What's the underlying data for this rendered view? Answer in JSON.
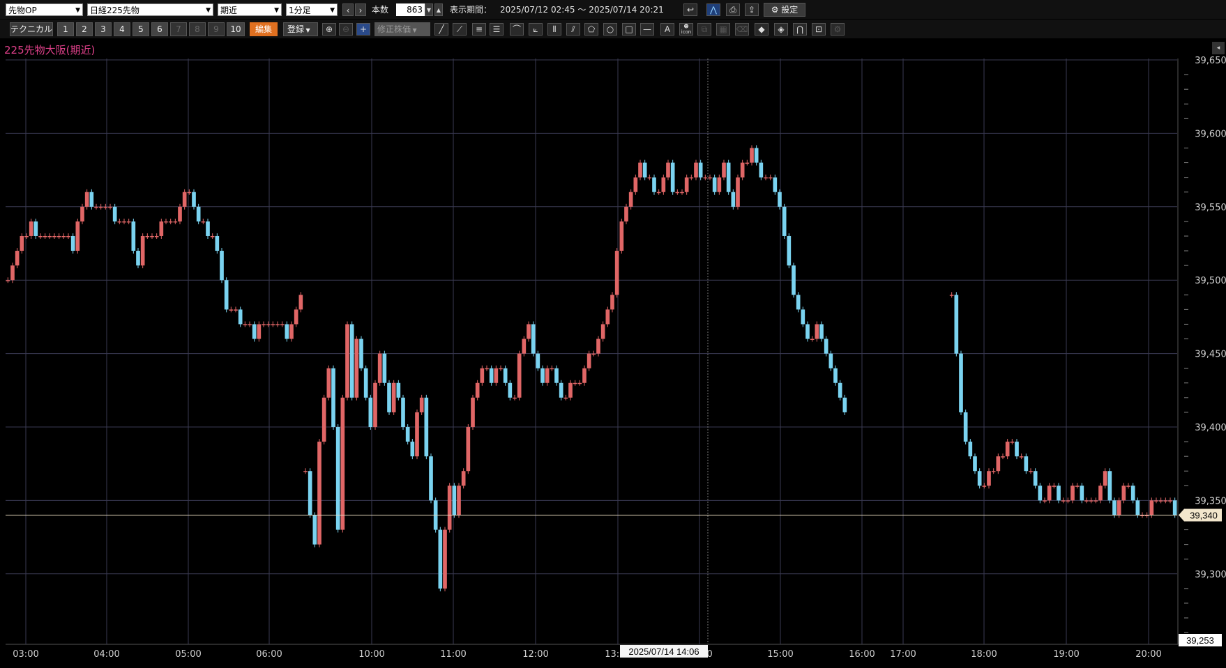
{
  "toolbar": {
    "market_select": "先物OP",
    "instrument_select": "日経225先物",
    "contract_select": "期近",
    "interval_select": "1分足",
    "prev_label": "‹",
    "next_label": "›",
    "count_label": "本数",
    "count_value": "863",
    "period_label": "表示期間：",
    "period_value": "2025/07/12 02:45 ～ 2025/07/14 20:21",
    "settings_label": "設定"
  },
  "toolbar2": {
    "technical_label": "テクニカル",
    "presets": [
      "1",
      "2",
      "3",
      "4",
      "5",
      "6",
      "7",
      "8",
      "9",
      "10"
    ],
    "edit_label": "編集",
    "register_label": "登録",
    "adjusted_price_label": "修正株価",
    "icon_label": "icon"
  },
  "chart_title": "225先物大阪(期近)",
  "colors": {
    "up": "#e06666",
    "down": "#7ad3f0",
    "grid": "#3a3a52",
    "title": "#e0408a",
    "price_line": "#e8dcc0"
  },
  "chart_data": {
    "type": "line",
    "x_tick_labels": [
      "03:00",
      "04:00",
      "05:00",
      "06:00",
      "10:00",
      "11:00",
      "12:00",
      "13:00",
      "14:00",
      "15:00",
      "16:00",
      "17:00",
      "18:00",
      "19:00",
      "20:00"
    ],
    "y_tick_labels": [
      "39,650",
      "39,600",
      "39,550",
      "39,500",
      "39,450",
      "39,400",
      "39,350",
      "39,300"
    ],
    "ylim": [
      39253,
      39650
    ],
    "current_price_label": "39,340",
    "current_price": 39340,
    "axis_min_label": "39,253",
    "crosshair_time_label": "2025/07/14 14:06",
    "segments": [
      {
        "start": 0,
        "values": [
          39500,
          39510,
          39520,
          39530,
          39530,
          39540,
          39530,
          39530,
          39530,
          39530,
          39530,
          39530,
          39530,
          39530,
          39520,
          39540,
          39550,
          39560,
          39550,
          39550,
          39550,
          39550,
          39550,
          39540,
          39540,
          39540,
          39540,
          39520,
          39510,
          39530,
          39530,
          39530,
          39530,
          39540,
          39540,
          39540,
          39540,
          39550,
          39560,
          39560,
          39550,
          39540,
          39540,
          39530,
          39530,
          39520,
          39500,
          39480,
          39480,
          39480,
          39470,
          39470,
          39470,
          39460,
          39470,
          39470,
          39470,
          39470,
          39470,
          39470,
          39460,
          39470,
          39480,
          39490
        ]
      },
      {
        "start": 64,
        "values": [
          39370,
          39340,
          39320,
          39390,
          39420,
          39440,
          39400,
          39330,
          39420,
          39470,
          39420,
          39460,
          39440,
          39420,
          39400,
          39430,
          39450,
          39430,
          39410,
          39430,
          39420,
          39400,
          39390,
          39380,
          39410,
          39420,
          39380,
          39350,
          39330,
          39290,
          39330,
          39360,
          39340,
          39360,
          39370,
          39400,
          39420,
          39430,
          39440,
          39440,
          39430,
          39440,
          39440,
          39430,
          39420,
          39420,
          39450,
          39460,
          39470,
          39450,
          39440,
          39430,
          39440,
          39440,
          39430,
          39420,
          39420,
          39430,
          39430,
          39430,
          39440,
          39450,
          39450,
          39460,
          39470,
          39480,
          39490,
          39520,
          39540,
          39550,
          39560,
          39570,
          39580,
          39570,
          39570,
          39560,
          39560,
          39570,
          39580,
          39560,
          39560,
          39560,
          39570,
          39570,
          39580,
          39570,
          39570,
          39570,
          39560,
          39570,
          39580,
          39560,
          39550,
          39570,
          39580,
          39580,
          39590,
          39580,
          39570,
          39570,
          39570,
          39560,
          39550,
          39530,
          39510,
          39490,
          39480,
          39470,
          39460,
          39460,
          39470,
          39460,
          39450,
          39440,
          39430,
          39420,
          39410
        ]
      },
      {
        "start": 203,
        "values": [
          39490,
          39450,
          39410,
          39390,
          39380,
          39370,
          39360,
          39360,
          39370,
          39370,
          39380,
          39380,
          39390,
          39390,
          39380,
          39380,
          39370,
          39370,
          39360,
          39350,
          39350,
          39360,
          39360,
          39350,
          39350,
          39350,
          39360,
          39360,
          39350,
          39350,
          39350,
          39350,
          39360,
          39370,
          39350,
          39340,
          39350,
          39360,
          39360,
          39350,
          39340,
          39340,
          39340,
          39350,
          39350,
          39350,
          39350,
          39350,
          39340
        ]
      }
    ]
  }
}
